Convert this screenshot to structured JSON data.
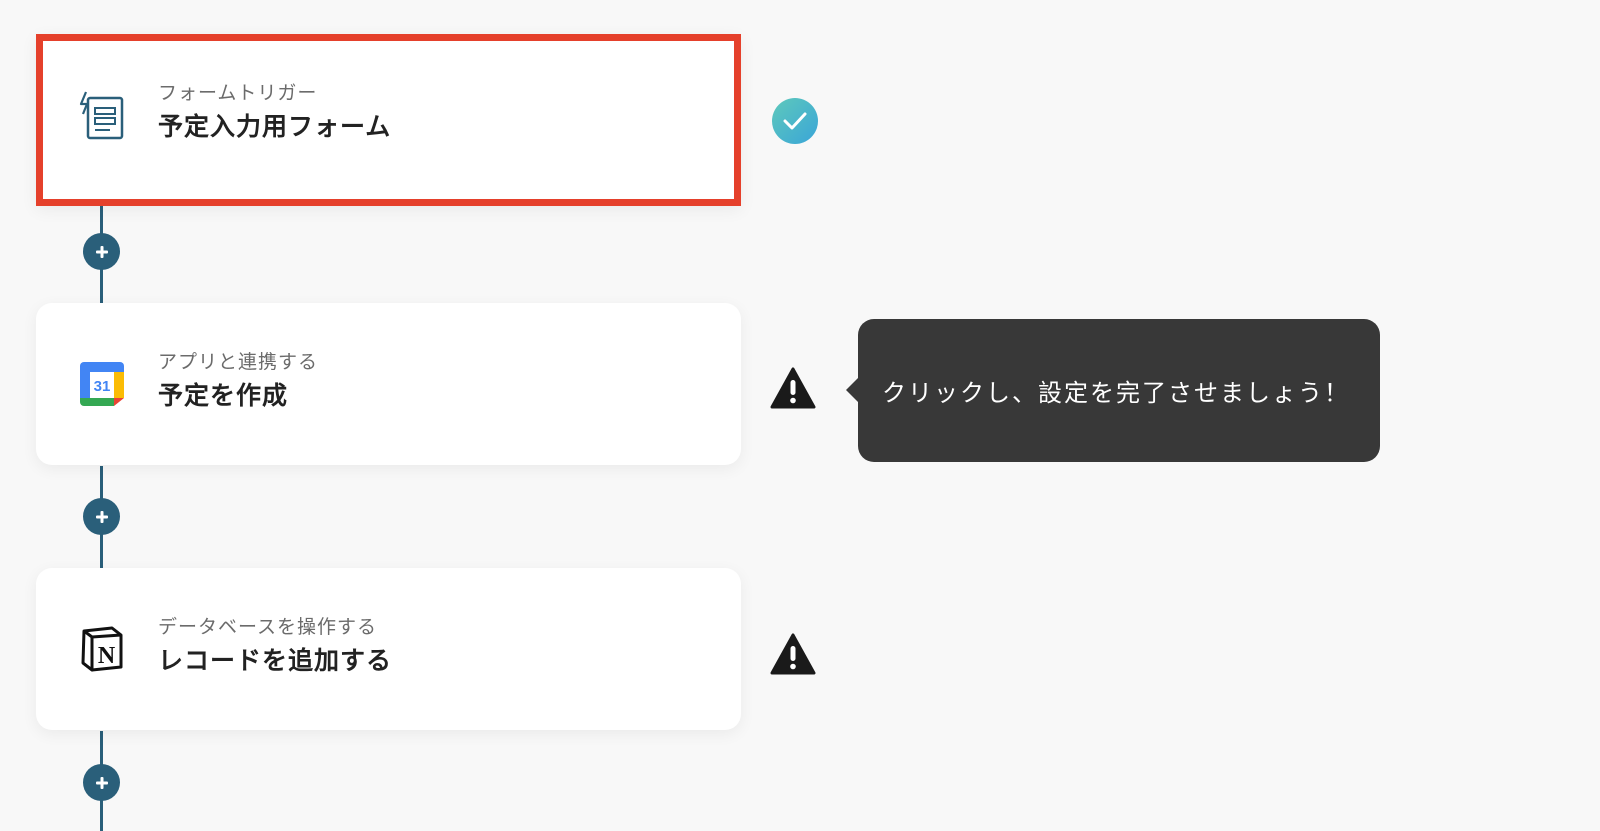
{
  "steps": [
    {
      "subtitle": "フォームトリガー",
      "title": "予定入力用フォーム",
      "icon": "form-trigger-icon",
      "status": "complete"
    },
    {
      "subtitle": "アプリと連携する",
      "title": "予定を作成",
      "icon": "google-calendar-icon",
      "icon_text": "31",
      "status": "warning"
    },
    {
      "subtitle": "データベースを操作する",
      "title": "レコードを追加する",
      "icon": "notion-icon",
      "icon_text": "N",
      "status": "warning"
    }
  ],
  "tooltip": {
    "text": "クリックし、設定を完了させましょう！"
  },
  "colors": {
    "accent": "#2a5f7a",
    "selected_border": "#e5402b",
    "complete": "#4cb8c8",
    "tooltip_bg": "#383838"
  }
}
